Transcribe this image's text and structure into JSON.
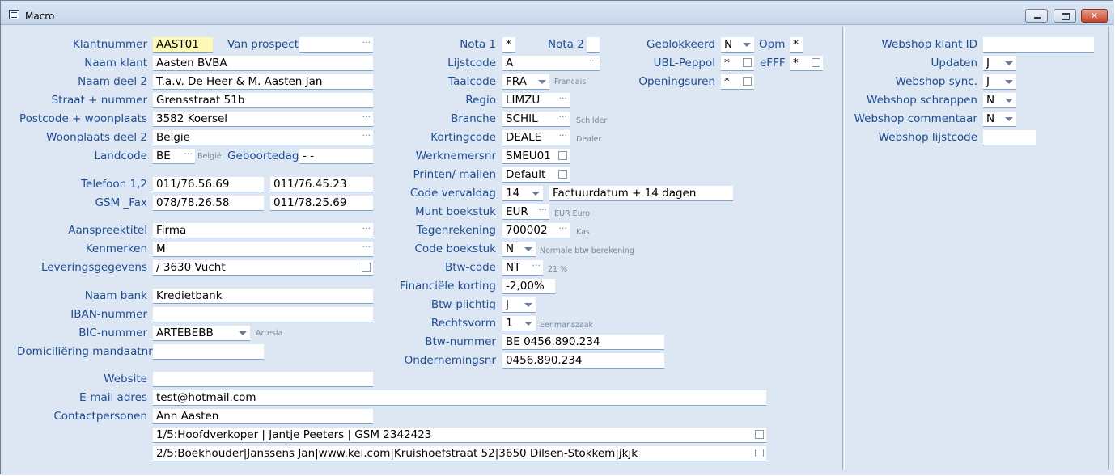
{
  "window": {
    "title": "Macro",
    "icon": "form-icon"
  },
  "form": {
    "klantnummer": {
      "label": "Klantnummer",
      "value": "AAST01"
    },
    "van_prospect": {
      "label": "Van prospect",
      "value": ""
    },
    "naam_klant": {
      "label": "Naam klant",
      "value": "Aasten BVBA"
    },
    "naam_deel2": {
      "label": "Naam deel 2",
      "value": "T.a.v. De Heer & M. Aasten Jan"
    },
    "straat": {
      "label": "Straat + nummer",
      "value": "Grensstraat 51b"
    },
    "postcode": {
      "label": "Postcode + woonplaats",
      "value": "3582 Koersel"
    },
    "woonplaats2": {
      "label": "Woonplaats deel 2",
      "value": "Belgie"
    },
    "landcode": {
      "label": "Landcode",
      "value": "BE",
      "hint": "België"
    },
    "geboortedag": {
      "label": "Geboortedag",
      "value": "-  -"
    },
    "telefoon": {
      "label": "Telefoon 1,2",
      "value1": "011/76.56.69",
      "value2": "011/76.45.23"
    },
    "gsm_fax": {
      "label": "GSM _Fax",
      "value1": "078/78.26.58",
      "value2": "011/78.25.69"
    },
    "aanspreektitel": {
      "label": "Aanspreektitel",
      "value": "Firma"
    },
    "kenmerken": {
      "label": "Kenmerken",
      "value": "M"
    },
    "leveringsgegevens": {
      "label": "Leveringsgegevens",
      "value": "/ 3630 Vucht"
    },
    "naam_bank": {
      "label": "Naam bank",
      "value": "Kredietbank"
    },
    "iban": {
      "label": "IBAN-nummer",
      "value": ""
    },
    "bic": {
      "label": "BIC-nummer",
      "value": "ARTEBEBB",
      "hint": "Artesia"
    },
    "domiciliering": {
      "label": "Domiciliëring mandaatnr",
      "value": ""
    },
    "website": {
      "label": "Website",
      "value": ""
    },
    "email": {
      "label": "E-mail adres",
      "value": "test@hotmail.com"
    },
    "contactpersonen": {
      "label": "Contactpersonen",
      "value": "Ann Aasten"
    },
    "contact_line1": "1/5:Hoofdverkoper | Jantje Peeters | GSM 2342423",
    "contact_line2": "2/5:Boekhouder|Janssens Jan|www.kei.com|Kruishoefstraat 52|3650 Dilsen-Stokkem|jkjk"
  },
  "middle": {
    "nota1": {
      "label": "Nota 1",
      "value": "*"
    },
    "nota2": {
      "label": "Nota 2",
      "value": ""
    },
    "lijstcode": {
      "label": "Lijstcode",
      "value": "A"
    },
    "taalcode": {
      "label": "Taalcode",
      "value": "FRA",
      "hint": "Francais"
    },
    "regio": {
      "label": "Regio",
      "value": "LIMZU"
    },
    "branche": {
      "label": "Branche",
      "value": "SCHIL",
      "hint": "Schilder"
    },
    "kortingcode": {
      "label": "Kortingcode",
      "value": "DEALE",
      "hint": "Dealer"
    },
    "werknemersnr": {
      "label": "Werknemersnr",
      "value": "SMEU01"
    },
    "printen": {
      "label": "Printen/ mailen",
      "value": "Default"
    },
    "code_vervaldag": {
      "label": "Code vervaldag",
      "value": "14",
      "value2": "Factuurdatum + 14 dagen"
    },
    "munt": {
      "label": "Munt boekstuk",
      "value": "EUR",
      "hint": "EUR Euro"
    },
    "tegenrekening": {
      "label": "Tegenrekening",
      "value": "700002",
      "hint": "Kas"
    },
    "code_boekstuk": {
      "label": "Code boekstuk",
      "value": "N",
      "hint": "Normale btw berekening"
    },
    "btw_code": {
      "label": "Btw-code",
      "value": "NT",
      "hint": "21 %"
    },
    "fin_korting": {
      "label": "Financiële korting",
      "value": "-2,00%"
    },
    "btw_plichtig": {
      "label": "Btw-plichtig",
      "value": "J"
    },
    "rechtsvorm": {
      "label": "Rechtsvorm",
      "value": "1",
      "hint": "Eenmanszaak"
    },
    "btw_nummer": {
      "label": "Btw-nummer",
      "value": "BE 0456.890.234"
    },
    "ondernemingsnr": {
      "label": "Ondernemingsnr",
      "value": "0456.890.234"
    }
  },
  "flags": {
    "geblokkeerd": {
      "label": "Geblokkeerd",
      "value": "N"
    },
    "opm": {
      "label": "Opm",
      "value": "*"
    },
    "ubl_peppol": {
      "label": "UBL-Peppol",
      "value": "*"
    },
    "efff": {
      "label": "eFFF",
      "value": "*"
    },
    "openingsuren": {
      "label": "Openingsuren",
      "value": "*"
    }
  },
  "webshop": {
    "klant_id": {
      "label": "Webshop klant ID",
      "value": ""
    },
    "updaten": {
      "label": "Updaten",
      "value": "J"
    },
    "sync": {
      "label": "Webshop sync.",
      "value": "J"
    },
    "schrappen": {
      "label": "Webshop schrappen",
      "value": "N"
    },
    "commentaar": {
      "label": "Webshop commentaar",
      "value": "N"
    },
    "lijstcode": {
      "label": "Webshop lijstcode",
      "value": ""
    }
  }
}
